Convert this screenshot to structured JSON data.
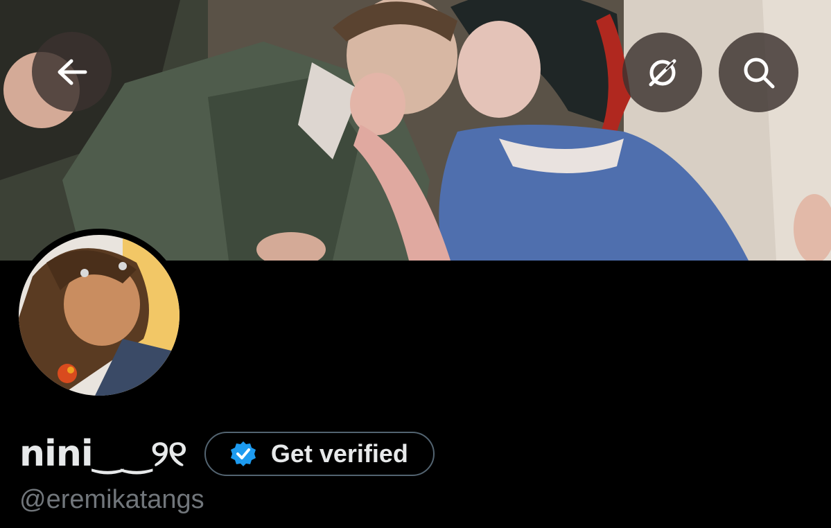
{
  "header": {
    "back_icon": "arrow-left-icon",
    "grok_icon": "grok-icon",
    "search_icon": "search-icon"
  },
  "profile": {
    "display_name": "nini‿‿୨୧",
    "handle": "@eremikatangs",
    "verify_button_label": "Get verified",
    "verify_icon": "verified-badge-icon"
  },
  "colors": {
    "background": "#000000",
    "text_primary": "#e7e9ea",
    "text_secondary": "#71767b",
    "border": "#536471",
    "verified_blue": "#1d9bf0"
  }
}
